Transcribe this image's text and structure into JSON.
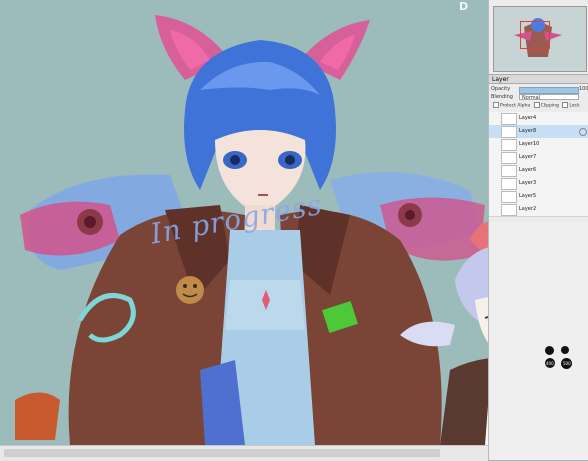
{
  "watermark": "D",
  "art": {
    "sketch_text": "In progress"
  },
  "navigator": {},
  "layer_panel": {
    "tab_label": "Layer",
    "opacity_label": "Opacity",
    "opacity_value": "100",
    "blending_label": "Blending",
    "blending_value": "Normal",
    "options": [
      "Protect Alpha",
      "Clipping",
      "Lock"
    ],
    "layers": [
      {
        "name": "Layer4",
        "selected": false
      },
      {
        "name": "Layer8",
        "selected": true
      },
      {
        "name": "Layer10",
        "selected": false
      },
      {
        "name": "Layer7",
        "selected": false
      },
      {
        "name": "Layer6",
        "selected": false
      },
      {
        "name": "Layer3",
        "selected": false
      },
      {
        "name": "Layer5",
        "selected": false
      },
      {
        "name": "Layer2",
        "selected": false
      }
    ]
  },
  "brush_size_labels": [
    "400",
    "500"
  ]
}
